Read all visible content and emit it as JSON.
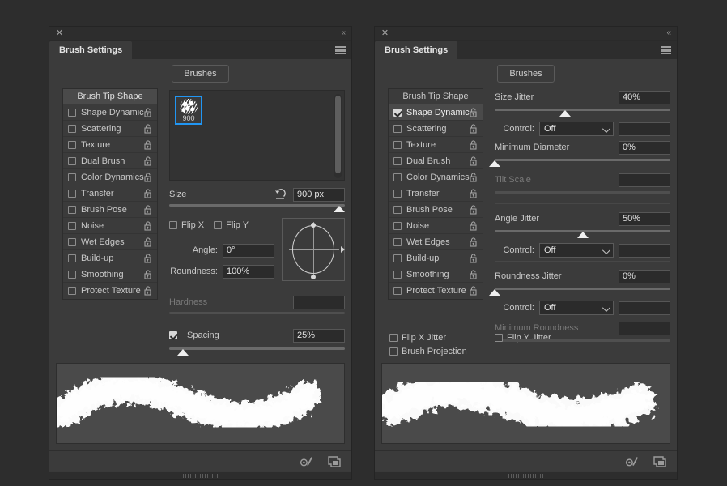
{
  "window": {
    "close_icon": "close-icon",
    "collapse_icon": "double-chevron-left-icon",
    "menu_icon": "hamburger-menu-icon",
    "tab_title": "Brush Settings",
    "brushes_button": "Brushes"
  },
  "options_list": {
    "header": "Brush Tip Shape",
    "items": [
      "Shape Dynamics",
      "Scattering",
      "Texture",
      "Dual Brush",
      "Color Dynamics",
      "Transfer",
      "Brush Pose",
      "Noise",
      "Wet Edges",
      "Build-up",
      "Smoothing",
      "Protect Texture"
    ]
  },
  "left_panel": {
    "selected_option": "Brush Tip Shape",
    "checked_options": [],
    "brush_tip": {
      "label": "900",
      "selected": true
    },
    "size": {
      "label": "Size",
      "value": "900 px",
      "slider_pct": 97,
      "reset_icon": "reset-arrow-icon"
    },
    "flip_x": {
      "label": "Flip X",
      "checked": false
    },
    "flip_y": {
      "label": "Flip Y",
      "checked": false
    },
    "angle": {
      "label": "Angle:",
      "value": "0°"
    },
    "roundness": {
      "label": "Roundness:",
      "value": "100%"
    },
    "hardness": {
      "label": "Hardness",
      "value": "",
      "enabled": false,
      "slider_pct": 0
    },
    "spacing": {
      "label": "Spacing",
      "value": "25%",
      "checked": true,
      "slider_pct": 8
    }
  },
  "right_panel": {
    "selected_option": "Shape Dynamics",
    "checked_options": [
      "Shape Dynamics"
    ],
    "size_jitter": {
      "label": "Size Jitter",
      "value": "40%",
      "slider_pct": 40
    },
    "size_control": {
      "label": "Control:",
      "value": "Off",
      "extra_value": ""
    },
    "minimum_diameter": {
      "label": "Minimum Diameter",
      "value": "0%",
      "slider_pct": 0
    },
    "tilt_scale": {
      "label": "Tilt Scale",
      "value": "",
      "enabled": false,
      "slider_pct": 0
    },
    "angle_jitter": {
      "label": "Angle Jitter",
      "value": "50%",
      "slider_pct": 50
    },
    "angle_control": {
      "label": "Control:",
      "value": "Off",
      "extra_value": ""
    },
    "roundness_jitter": {
      "label": "Roundness Jitter",
      "value": "0%",
      "slider_pct": 0
    },
    "roundness_control": {
      "label": "Control:",
      "value": "Off",
      "extra_value": ""
    },
    "minimum_roundness": {
      "label": "Minimum Roundness",
      "value": "",
      "enabled": false,
      "slider_pct": 0
    },
    "flip_x_jitter": {
      "label": "Flip X Jitter",
      "checked": false
    },
    "flip_y_jitter": {
      "label": "Flip Y Jitter",
      "checked": false
    },
    "brush_projection": {
      "label": "Brush Projection",
      "checked": false
    }
  },
  "footer": {
    "brush_preview_icon": "brush-toggle-icon",
    "new_brush_icon": "new-brush-preset-icon"
  },
  "colors": {
    "accent": "#2196f3",
    "panel_bg": "#3b3b3b",
    "app_bg": "#2d2d2d",
    "preview_bg": "#4a4a4a",
    "text": "#c9c9c9"
  }
}
